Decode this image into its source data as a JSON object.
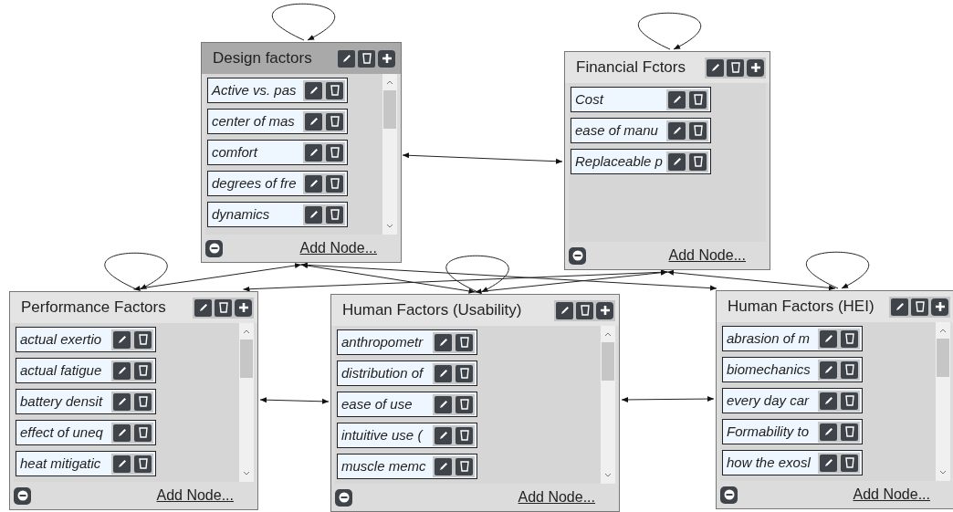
{
  "cards": [
    {
      "title": "Design factors",
      "selected": true,
      "scrollable": true,
      "items": [
        "Active vs. pas",
        "center of mas",
        "comfort",
        "degrees of fre",
        "dynamics"
      ],
      "add_link": "Add Node..."
    },
    {
      "title": "Financial Fctors",
      "selected": false,
      "scrollable": false,
      "items": [
        "Cost",
        "ease of manu",
        "Replaceable p"
      ],
      "add_link": "Add Node..."
    },
    {
      "title": "Performance Factors",
      "selected": false,
      "scrollable": true,
      "items": [
        "actual exertio",
        "actual fatigue",
        "battery densit",
        "effect of uneq",
        "heat mitigatic"
      ],
      "add_link": "Add Node..."
    },
    {
      "title": "Human Factors (Usability)",
      "selected": false,
      "scrollable": true,
      "items": [
        "anthropometr",
        "distribution of",
        "ease of use",
        "intuitive use (",
        "muscle memc"
      ],
      "add_link": "Add Node..."
    },
    {
      "title": "Human Factors (HEI)",
      "selected": false,
      "scrollable": true,
      "items": [
        "abrasion of m",
        "biomechanics",
        "every day car",
        "Formability to",
        "how the exosl"
      ],
      "add_link": "Add Node..."
    }
  ]
}
